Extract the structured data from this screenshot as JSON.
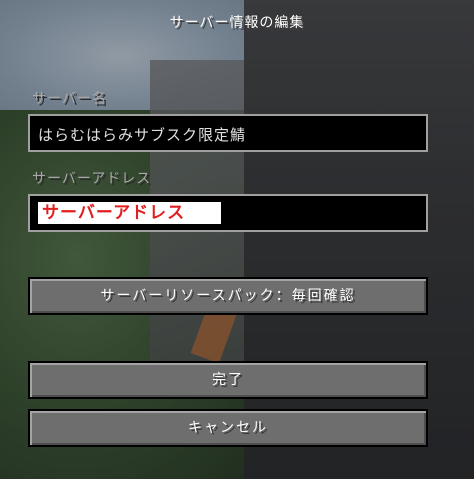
{
  "screen": {
    "title": "サーバー情報の編集"
  },
  "form": {
    "server_name_label": "サーバー名",
    "server_name_value": "はらむはらみサブスク限定鯖",
    "server_address_label": "サーバーアドレス",
    "server_address_value": "サーバーアドレス",
    "resource_pack_button": "サーバーリソースパック：毎回確認",
    "done_button": "完了",
    "cancel_button": "キャンセル"
  },
  "colors": {
    "label": "#a8a8a8",
    "field_bg": "#000000",
    "button_bg": "#6e6e6e",
    "highlight_text": "#e02020"
  }
}
